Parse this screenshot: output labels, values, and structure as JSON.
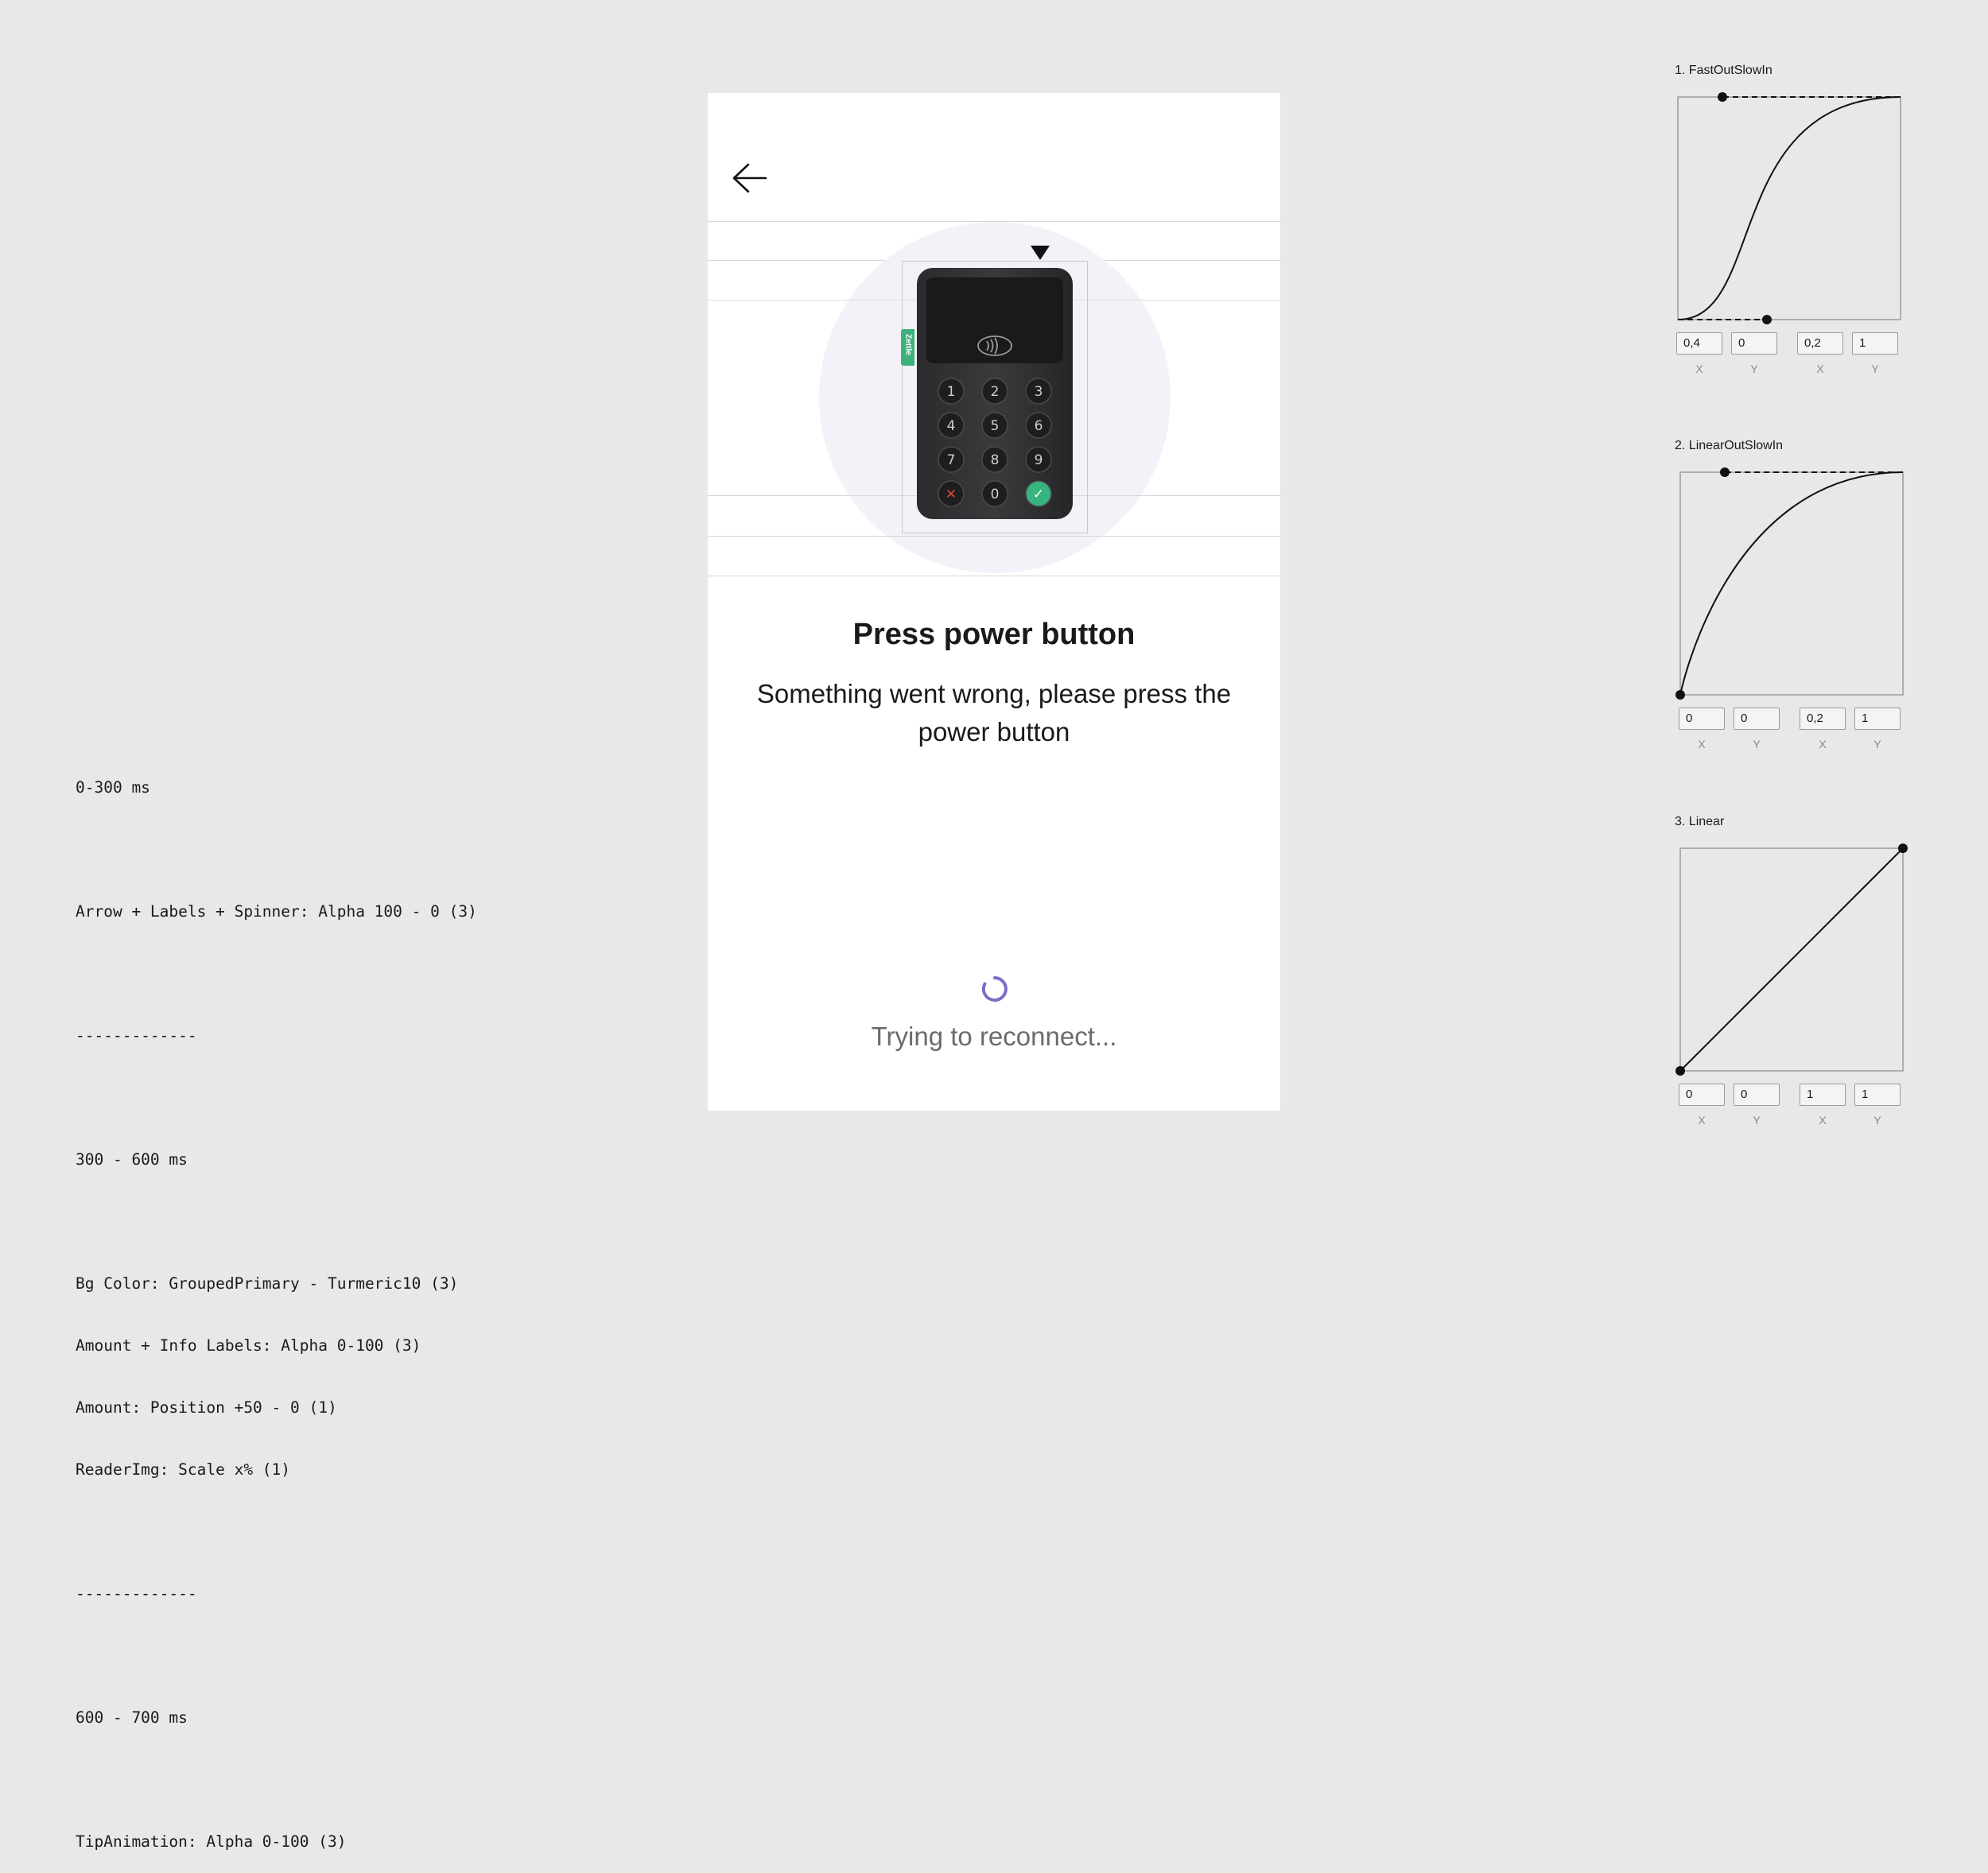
{
  "notes": [
    "0-300 ms",
    "",
    "Arrow + Labels + Spinner: Alpha 100 - 0 (3)",
    "",
    "-------------",
    "",
    "300 - 600 ms",
    "",
    "Bg Color: GroupedPrimary - Turmeric10 (3)",
    "Amount + Info Labels: Alpha 0-100 (3)",
    "Amount: Position +50 - 0 (1)",
    "ReaderImg: Scale x% (1)",
    "",
    "-------------",
    "",
    "600 - 700 ms",
    "",
    "TipAnimation: Alpha 0-100 (3)"
  ],
  "phone": {
    "back_icon": "arrow-left-icon",
    "title": "Press power button",
    "message": "Something went wrong, please press the power button",
    "status": "Trying to reconnect...",
    "spinner_color": "#7b6fc4",
    "reader": {
      "brand": "Zettle",
      "keys": [
        "1",
        "2",
        "3",
        "4",
        "5",
        "6",
        "7",
        "8",
        "9",
        "✕",
        "0",
        "✓"
      ],
      "cancel_color": "#e0473b",
      "confirm_color": "#36b37e",
      "contactless_icon": "contactless-icon"
    }
  },
  "easings": [
    {
      "title": "1. FastOutSlowIn",
      "fields": [
        {
          "label": "X",
          "value": "0,4"
        },
        {
          "label": "Y",
          "value": "0"
        },
        {
          "label": "X",
          "value": "0,2"
        },
        {
          "label": "Y",
          "value": "1"
        }
      ],
      "control_points": [
        [
          0.4,
          0
        ],
        [
          0.2,
          1
        ]
      ]
    },
    {
      "title": "2. LinearOutSlowIn",
      "fields": [
        {
          "label": "X",
          "value": "0"
        },
        {
          "label": "Y",
          "value": "0"
        },
        {
          "label": "X",
          "value": "0,2"
        },
        {
          "label": "Y",
          "value": "1"
        }
      ],
      "control_points": [
        [
          0,
          0
        ],
        [
          0.2,
          1
        ]
      ]
    },
    {
      "title": "3. Linear",
      "fields": [
        {
          "label": "X",
          "value": "0"
        },
        {
          "label": "Y",
          "value": "0"
        },
        {
          "label": "X",
          "value": "1"
        },
        {
          "label": "Y",
          "value": "1"
        }
      ],
      "control_points": [
        [
          0,
          0
        ],
        [
          1,
          1
        ]
      ]
    }
  ]
}
